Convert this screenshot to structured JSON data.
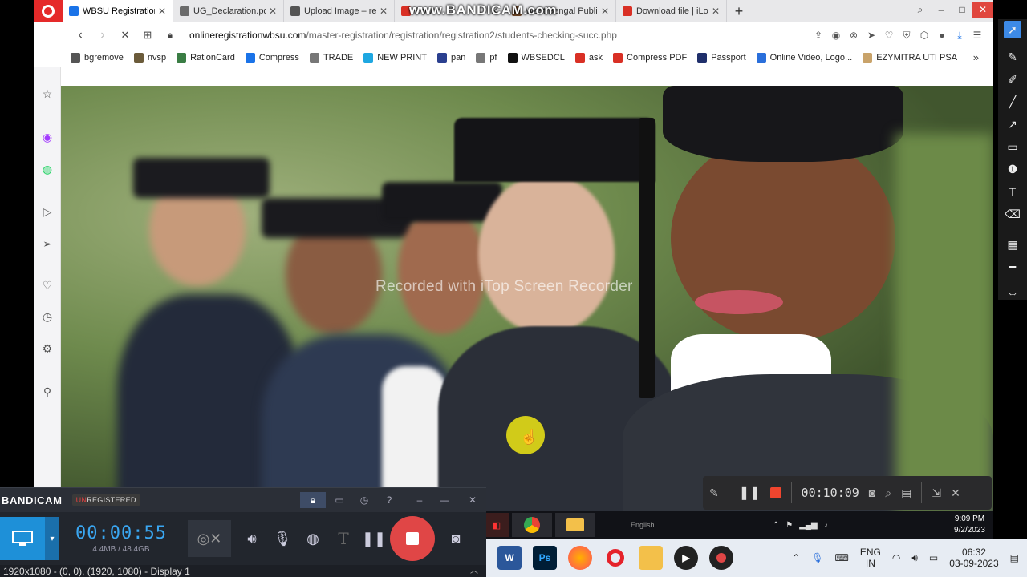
{
  "bandicam_watermark": "www.BANDICAM.com",
  "browser": {
    "tabs": [
      {
        "label": "WBSU Registration",
        "color": "#1a73e8",
        "active": true
      },
      {
        "label": "UG_Declaration.pdf",
        "color": "#6b6b6b",
        "active": false
      },
      {
        "label": "Upload Image – resi",
        "color": "#555555",
        "active": false
      },
      {
        "label": "Dow",
        "color": "#d93025",
        "active": false
      },
      {
        "label": "West Bengal Public",
        "color": "#7a4d2a",
        "active": false
      },
      {
        "label": "Download file | iLov",
        "color": "#d93025",
        "active": false
      }
    ],
    "url_host": "onlineregistrationwbsu.com",
    "url_path": "/master-registration/registration/registration2/students-checking-succ.php",
    "bookmarks": [
      {
        "label": "bgremove",
        "color": "#555555"
      },
      {
        "label": "nvsp",
        "color": "#6b5b3a"
      },
      {
        "label": "RationCard",
        "color": "#3a7d44"
      },
      {
        "label": "Compress",
        "color": "#1a73e8"
      },
      {
        "label": "TRADE",
        "color": "#777777"
      },
      {
        "label": "NEW PRINT",
        "color": "#1ea7e1"
      },
      {
        "label": "pan",
        "color": "#2a3f8f"
      },
      {
        "label": "pf",
        "color": "#777777"
      },
      {
        "label": "WBSEDCL",
        "color": "#111111"
      },
      {
        "label": "ask",
        "color": "#d93025"
      },
      {
        "label": "Compress PDF",
        "color": "#d93025"
      },
      {
        "label": "Passport",
        "color": "#1f2f6b"
      },
      {
        "label": "Online Video, Logo...",
        "color": "#2a6fdb"
      },
      {
        "label": "EZYMITRA UTI PSA",
        "color": "#c9a36a"
      }
    ],
    "sidebar_icons": [
      "home-icon",
      "star-icon",
      "messenger-icon",
      "whatsapp-icon",
      "play-icon",
      "send-icon",
      "heart-icon",
      "clock-icon",
      "settings-icon",
      "lightbulb-icon"
    ],
    "page_watermark": "Recorded with iTop Screen Recorder"
  },
  "itop": {
    "time": "00:10:09"
  },
  "inner_taskbar": {
    "lang": "English",
    "clock_time": "9:09 PM",
    "clock_date": "9/2/2023"
  },
  "bandicam": {
    "logo": "BANDICAM",
    "unregistered_prefix": "UN",
    "unregistered_rest": "REGISTERED",
    "timer": "00:00:55",
    "size": "4.4MB / 48.4GB",
    "status": "1920x1080 - (0, 0), (1920, 1080) - Display 1"
  },
  "taskbar": {
    "lang_top": "ENG",
    "lang_bottom": "IN",
    "time": "06:32",
    "date": "03-09-2023"
  },
  "colors": {
    "bandicam_accent": "#1e90d8",
    "record_red": "#e04646",
    "timer_blue": "#3aa7f2"
  }
}
